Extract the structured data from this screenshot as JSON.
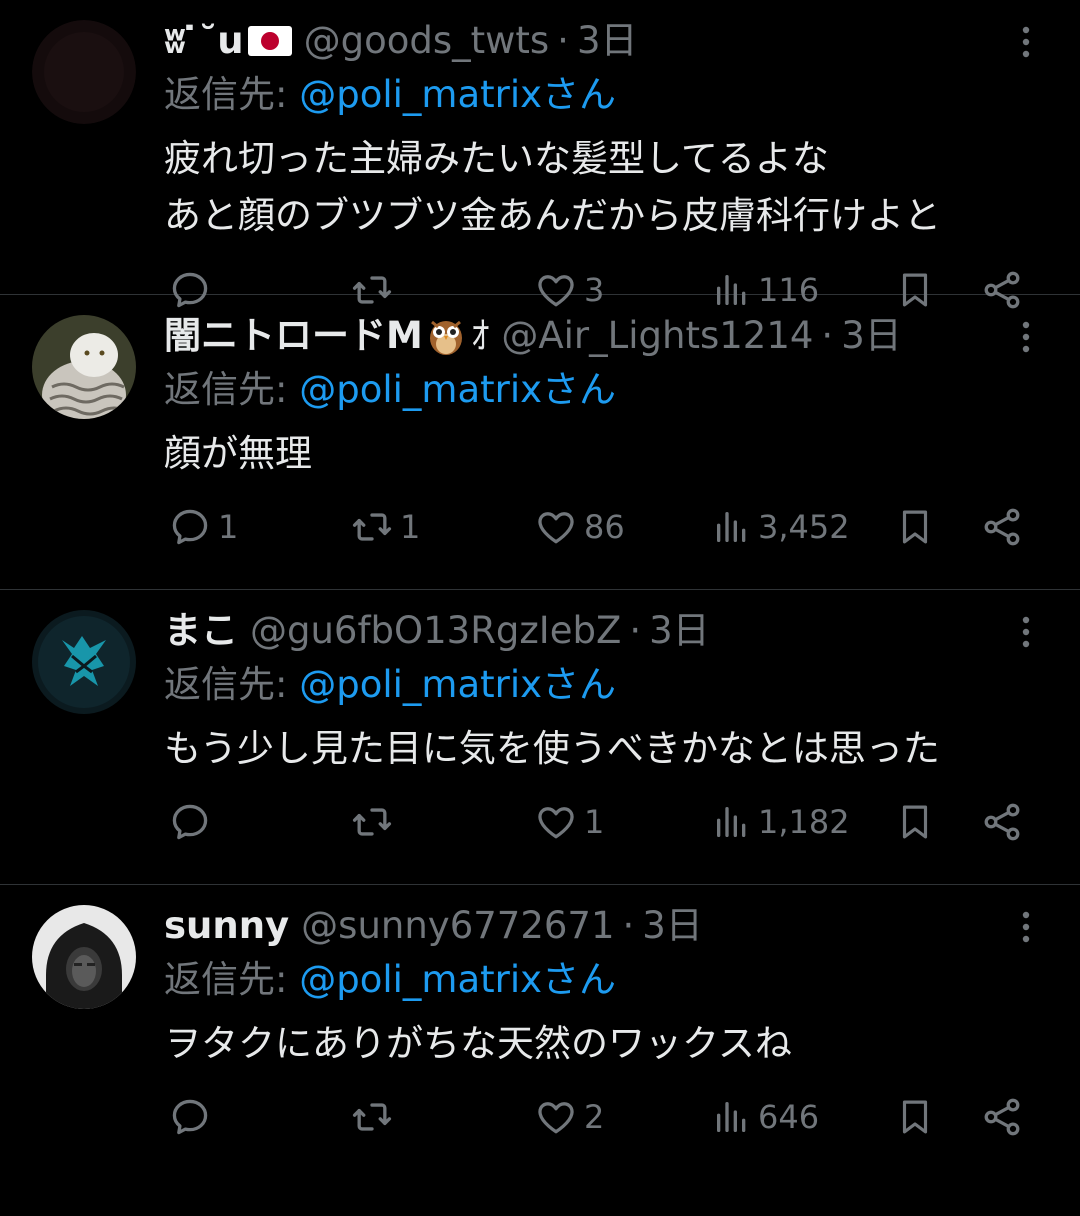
{
  "colors": {
    "background": "#000000",
    "text": "#e7e9ea",
    "muted": "#71767b",
    "link": "#1d9bf0",
    "divider": "#2f3336"
  },
  "tweets": [
    {
      "display_name": "ʬ ̇˘u",
      "name_emoji": "japan-flag-emoji",
      "handle": "@goods_twts",
      "dot": "·",
      "time": "3日",
      "reply_prefix": "返信先: ",
      "reply_mention": "@poli_matrixさん",
      "lines": [
        "疲れ切った主婦みたいな髪型してるよな",
        "あと顔のブツブツ金あんだから皮膚科行けよと"
      ],
      "avatar_icon": "dark-avatar",
      "counts": {
        "reply": "",
        "retweet": "",
        "like": "3",
        "views": "116"
      }
    },
    {
      "display_name": "闇ニトロードM",
      "name_emoji": "owl-emoji",
      "name_suffix": "ｵ",
      "handle": "@Air_Lights1214",
      "dot": "·",
      "time": "3日",
      "reply_prefix": "返信先: ",
      "reply_mention": "@poli_matrixさん",
      "lines": [
        "顔が無理"
      ],
      "avatar_icon": "snowy-owl-avatar",
      "counts": {
        "reply": "1",
        "retweet": "1",
        "like": "86",
        "views": "3,452"
      }
    },
    {
      "display_name": "まこ",
      "handle": "@gu6fbO13RgzIebZ",
      "dot": "·",
      "time": "3日",
      "reply_prefix": "返信先: ",
      "reply_mention": "@poli_matrixさん",
      "lines": [
        "もう少し見た目に気を使うべきかなとは思った"
      ],
      "avatar_icon": "teal-emblem-avatar",
      "counts": {
        "reply": "",
        "retweet": "",
        "like": "1",
        "views": "1,182"
      }
    },
    {
      "display_name": "sunny",
      "handle": "@sunny6772671",
      "dot": "·",
      "time": "3日",
      "reply_prefix": "返信先: ",
      "reply_mention": "@poli_matrixさん",
      "lines": [
        "ヲタクにありがちな天然のワックスね"
      ],
      "avatar_icon": "hooded-person-avatar",
      "counts": {
        "reply": "",
        "retweet": "",
        "like": "2",
        "views": "646"
      }
    }
  ]
}
